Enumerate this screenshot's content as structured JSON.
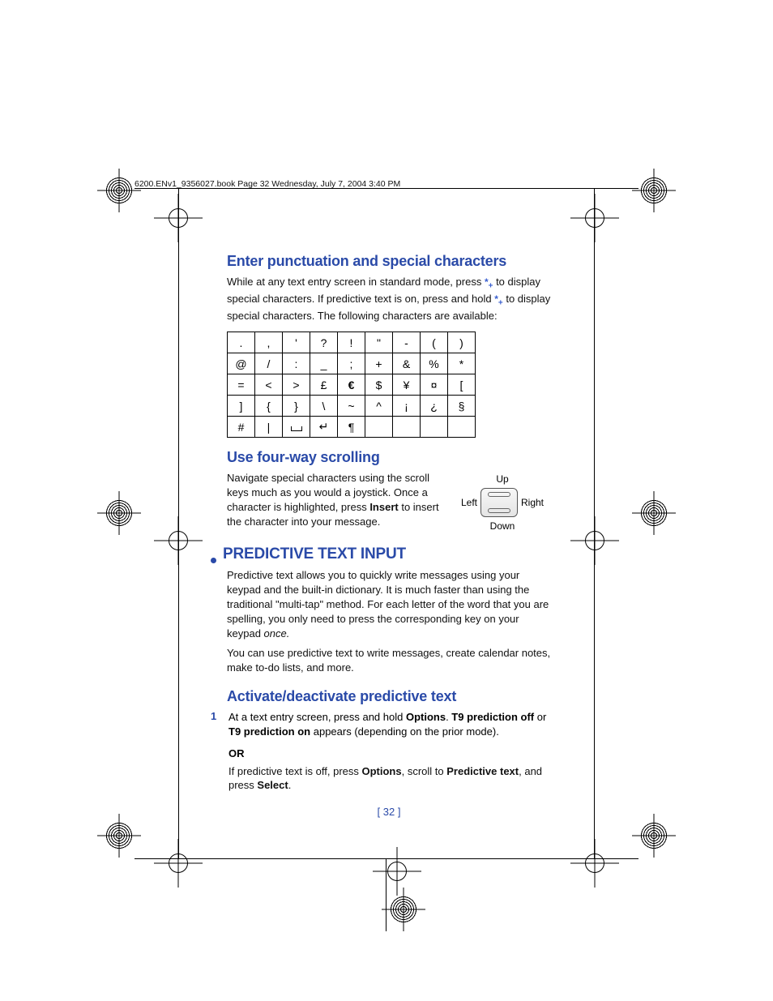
{
  "header": {
    "running": "6200.ENv1_9356027.book  Page 32  Wednesday, July 7, 2004  3:40 PM"
  },
  "sections": {
    "punctuation": {
      "title": "Enter punctuation and special characters",
      "body_a": "While at any text entry screen in standard mode, press ",
      "body_b": " to display special characters. If predictive text is on, press and hold ",
      "body_c": " to display special characters. The following characters are available:",
      "star1": "*",
      "star1sub": "+",
      "star2": "*",
      "star2sub": "+"
    },
    "char_table": {
      "rows": [
        [
          ".",
          ",",
          "'",
          "?",
          "!",
          "\"",
          "-",
          "(",
          ")"
        ],
        [
          "@",
          "/",
          ":",
          "_",
          ";",
          "+",
          "&",
          "%",
          "*"
        ],
        [
          "=",
          "<",
          ">",
          "£",
          "€",
          "$",
          "¥",
          "¤",
          "["
        ],
        [
          "]",
          "{",
          "}",
          "\\",
          "~",
          "^",
          "¡",
          "¿",
          "§"
        ],
        [
          "#",
          "|",
          "␣",
          "↵",
          "¶",
          "",
          "",
          "",
          ""
        ]
      ]
    },
    "scrolling": {
      "title": "Use four-way scrolling",
      "body_a": "Navigate special characters using the scroll keys much as you would a joystick. Once a character is highlighted, press ",
      "insert": "Insert",
      "body_b": " to insert the character into your message.",
      "labels": {
        "up": "Up",
        "down": "Down",
        "left": "Left",
        "right": "Right"
      }
    },
    "predictive": {
      "heading": "PREDICTIVE TEXT INPUT",
      "p1": "Predictive text allows you to quickly write messages using your keypad and the built-in dictionary. It is much faster than using the traditional \"multi-tap\" method. For each letter of the word that you are spelling, you only need to press the corresponding key on your keypad ",
      "p1_italic": "once.",
      "p2": "You can use predictive text to write messages, create calendar notes, make to-do lists, and more."
    },
    "activate": {
      "title": "Activate/deactivate predictive text",
      "step_num": "1",
      "s1_a": "At a text entry screen, press and hold ",
      "s1_options": "Options",
      "s1_b": ". ",
      "s1_off": "T9 prediction off",
      "s1_c": " or ",
      "s1_on": "T9 prediction on",
      "s1_d": " appears (depending on the prior mode).",
      "or": "OR",
      "s2_a": "If predictive text is off, press ",
      "s2_options": "Options",
      "s2_b": ", scroll to ",
      "s2_pred": "Predictive text",
      "s2_c": ", and press ",
      "s2_select": "Select",
      "s2_d": "."
    }
  },
  "page_number": "[ 32 ]",
  "chart_data": {
    "type": "table",
    "title": "Available special characters",
    "rows": [
      [
        ".",
        ",",
        "'",
        "?",
        "!",
        "\"",
        "-",
        "(",
        ")"
      ],
      [
        "@",
        "/",
        ":",
        "_",
        ";",
        "+",
        "&",
        "%",
        "*"
      ],
      [
        "=",
        "<",
        ">",
        "£",
        "€",
        "$",
        "¥",
        "¤",
        "["
      ],
      [
        "]",
        "{",
        "}",
        "\\",
        "~",
        "^",
        "¡",
        "¿",
        "§"
      ],
      [
        "#",
        "|",
        "space",
        "return",
        "¶",
        "",
        "",
        "",
        ""
      ]
    ]
  }
}
